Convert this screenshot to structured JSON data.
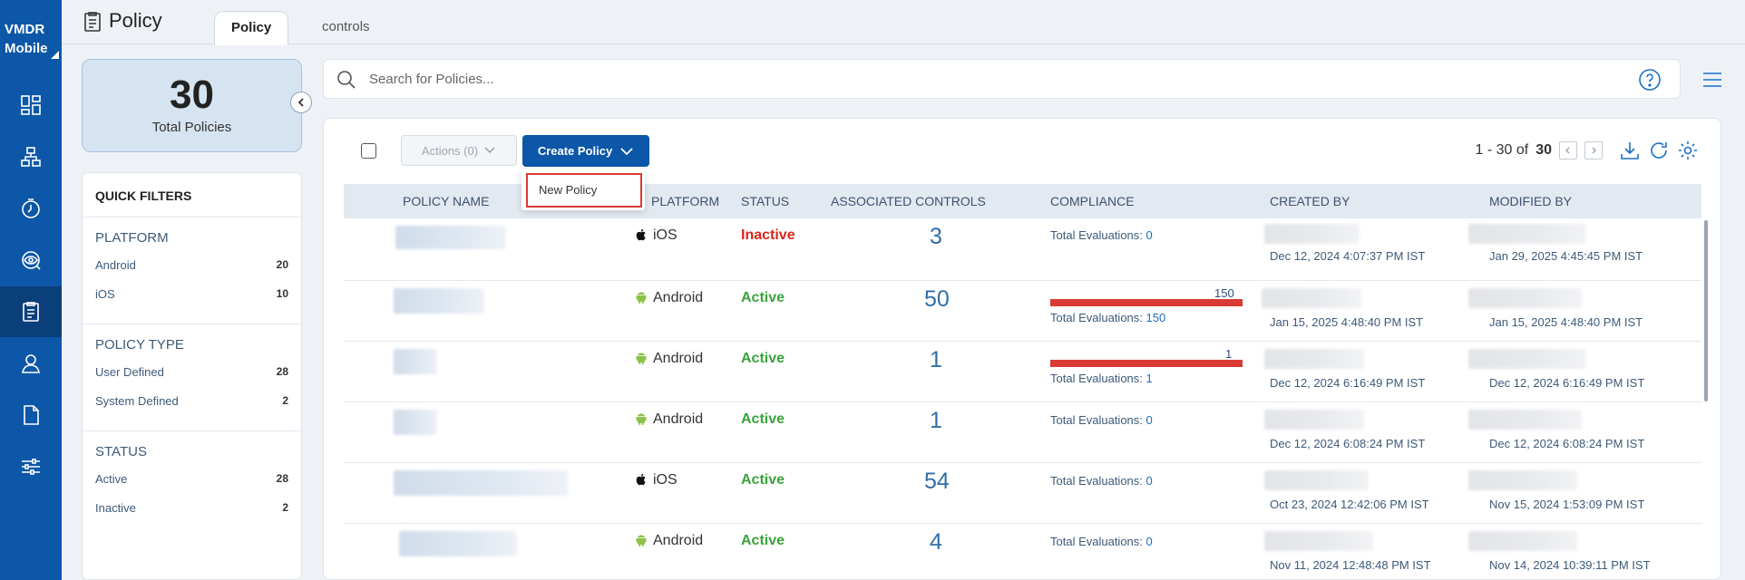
{
  "app": {
    "brand_line1": "VMDR",
    "brand_line2": "Mobile"
  },
  "nav": {
    "items": [
      {
        "name": "dashboard-icon"
      },
      {
        "name": "hierarchy-icon"
      },
      {
        "name": "timer-icon"
      },
      {
        "name": "eye-target-icon"
      },
      {
        "name": "policy-document-icon",
        "active": true
      },
      {
        "name": "user-icon"
      },
      {
        "name": "file-icon"
      },
      {
        "name": "sliders-icon"
      }
    ]
  },
  "header": {
    "title": "Policy",
    "tabs": [
      {
        "label": "Policy",
        "active": true
      },
      {
        "label": "controls"
      }
    ]
  },
  "summary": {
    "count": "30",
    "label": "Total Policies"
  },
  "filters": {
    "title": "QUICK FILTERS",
    "groups": [
      {
        "title": "PLATFORM",
        "items": [
          {
            "label": "Android",
            "count": "20"
          },
          {
            "label": "iOS",
            "count": "10"
          }
        ]
      },
      {
        "title": "POLICY TYPE",
        "items": [
          {
            "label": "User Defined",
            "count": "28"
          },
          {
            "label": "System Defined",
            "count": "2"
          }
        ]
      },
      {
        "title": "STATUS",
        "items": [
          {
            "label": "Active",
            "count": "28"
          },
          {
            "label": "Inactive",
            "count": "2"
          }
        ]
      }
    ]
  },
  "search": {
    "placeholder": "Search for Policies...",
    "value": ""
  },
  "toolbar": {
    "actions_label": "Actions (0)",
    "create_label": "Create Policy",
    "pager_range": "1 - 30 of",
    "pager_total": "30"
  },
  "dropdown": {
    "items": [
      {
        "label": "New Policy"
      }
    ]
  },
  "table": {
    "headers": {
      "name": "POLICY NAME",
      "platform": "PLATFORM",
      "status": "STATUS",
      "controls": "ASSOCIATED CONTROLS",
      "compliance": "COMPLIANCE",
      "created": "CREATED BY",
      "modified": "MODIFIED BY"
    },
    "rows": [
      {
        "platform": "iOS",
        "status": "Inactive",
        "controls": "3",
        "eval_label": "Total Evaluations:",
        "eval_count": "0",
        "bar_value": null,
        "created": "Dec 12, 2024 4:07:37 PM IST",
        "modified": "Jan 29, 2025 4:45:45 PM IST"
      },
      {
        "platform": "Android",
        "status": "Active",
        "controls": "50",
        "eval_label": "Total Evaluations:",
        "eval_count": "150",
        "bar_value": "150",
        "created": "Jan 15, 2025 4:48:40 PM IST",
        "modified": "Jan 15, 2025 4:48:40 PM IST"
      },
      {
        "platform": "Android",
        "status": "Active",
        "controls": "1",
        "eval_label": "Total Evaluations:",
        "eval_count": "1",
        "bar_value": "1",
        "created": "Dec 12, 2024 6:16:49 PM IST",
        "modified": "Dec 12, 2024 6:16:49 PM IST"
      },
      {
        "platform": "Android",
        "status": "Active",
        "controls": "1",
        "eval_label": "Total Evaluations:",
        "eval_count": "0",
        "bar_value": null,
        "created": "Dec 12, 2024 6:08:24 PM IST",
        "modified": "Dec 12, 2024 6:08:24 PM IST"
      },
      {
        "platform": "iOS",
        "status": "Active",
        "controls": "54",
        "eval_label": "Total Evaluations:",
        "eval_count": "0",
        "bar_value": null,
        "created": "Oct 23, 2024 12:42:06 PM IST",
        "modified": "Nov 15, 2024 1:53:09 PM IST"
      },
      {
        "platform": "Android",
        "status": "Active",
        "controls": "4",
        "eval_label": "Total Evaluations:",
        "eval_count": "0",
        "bar_value": null,
        "created": "Nov 11, 2024 12:48:48 PM IST",
        "modified": "Nov 14, 2024 10:39:11 PM IST"
      }
    ]
  },
  "colors": {
    "primary": "#0d57a8",
    "active": "#3aa23c",
    "inactive": "#d9261c",
    "compliance_bar": "#d93a34"
  }
}
